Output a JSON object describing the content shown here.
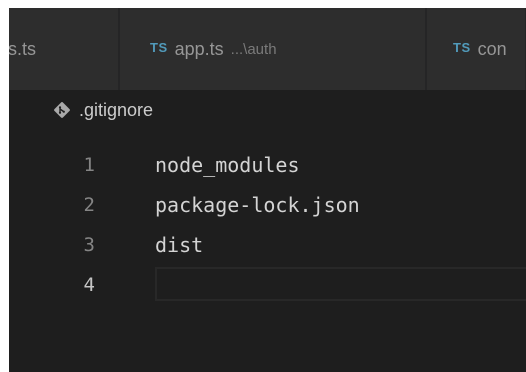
{
  "tabs": [
    {
      "label": "ts.ts",
      "has_icon": false
    },
    {
      "icon": "TS",
      "label": "app.ts",
      "path": "...\\auth"
    },
    {
      "icon": "TS",
      "label": "con"
    }
  ],
  "breadcrumb": {
    "icon": "git-icon",
    "file": ".gitignore"
  },
  "editor": {
    "lines": [
      {
        "number": "1",
        "text": "node_modules"
      },
      {
        "number": "2",
        "text": "package-lock.json"
      },
      {
        "number": "3",
        "text": "dist"
      },
      {
        "number": "4",
        "text": ""
      }
    ],
    "active_line": "4"
  },
  "colors": {
    "editor_bg": "#1e1e1e",
    "tab_bg": "#2d2d2d",
    "ts_icon": "#519aba",
    "git_icon": "#a9a9a9"
  }
}
